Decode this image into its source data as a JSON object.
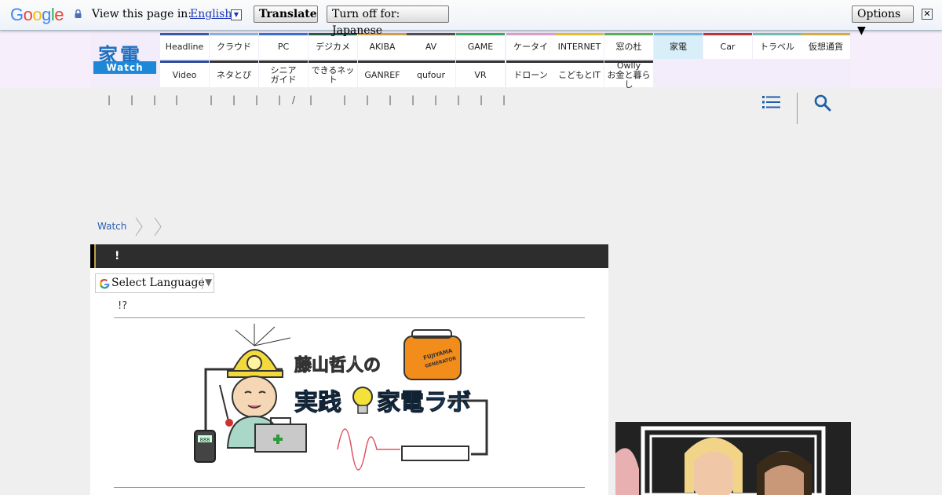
{
  "translate_bar": {
    "logo": "Google",
    "prompt": "View this page in:",
    "language": "English",
    "translate_label": "Translate",
    "turn_off_label": "Turn off for: Japanese",
    "options_label": "Options ▼",
    "close_label": "✕"
  },
  "brand": {
    "kanji": "家電",
    "watch": "Watch",
    "color": "#1e6fc0"
  },
  "nav_top": [
    {
      "label": "Headline",
      "color": "#3a5aa8"
    },
    {
      "label": "クラウド",
      "color": "#8ab0d8"
    },
    {
      "label": "PC",
      "color": "#3a6fd0"
    },
    {
      "label": "デジカメ",
      "color": "#2a5a4a"
    },
    {
      "label": "AKIBA",
      "color": "#c8a050"
    },
    {
      "label": "AV",
      "color": "#505050"
    },
    {
      "label": "GAME",
      "color": "#3aaa5a"
    },
    {
      "label": "ケータイ",
      "color": "#d8a0c8"
    },
    {
      "label": "INTERNET",
      "color": "#e0c030"
    },
    {
      "label": "窓の杜",
      "color": "#5ab05a"
    },
    {
      "label": "家電",
      "color": "#70b8e0"
    },
    {
      "label": "Car",
      "color": "#c03040"
    },
    {
      "label": "トラベル",
      "color": "#70c0b0"
    },
    {
      "label": "仮想通貨",
      "color": "#d0b040"
    }
  ],
  "nav_bottom": [
    {
      "label": "Video",
      "color": "#2a4aa0"
    },
    {
      "label": "ネタとぴ",
      "color": "#333333"
    },
    {
      "label": "シニア\nガイド",
      "color": "#333333"
    },
    {
      "label": "できるネット",
      "color": "#333333"
    },
    {
      "label": "GANREF",
      "color": "#333333"
    },
    {
      "label": "qufour",
      "color": "#333333"
    },
    {
      "label": "VR",
      "color": "#333333"
    },
    {
      "label": "ドローン",
      "color": "#333333"
    },
    {
      "label": "こどもとIT",
      "color": "#333333"
    },
    {
      "label": "Owlly\nお金と暮らし",
      "color": "#333333"
    }
  ],
  "sublinks": [
    "|",
    "|",
    "|",
    "|",
    "|",
    "|",
    "|",
    "|",
    "/",
    "|",
    "|",
    "|",
    "|",
    "|",
    "|",
    "|",
    "|",
    "|"
  ],
  "breadcrumb": {
    "home": "Watch"
  },
  "article": {
    "title": "!",
    "select_language": "Select Language",
    "lead": "!?",
    "banner": {
      "author_text": "藤山哲人の",
      "series_text_left": "実践",
      "series_text_right": "家電ラボ",
      "generator_label_1": "FUJIYAMA",
      "generator_label_2": "GENERATOR",
      "meter_reading": "888"
    }
  }
}
